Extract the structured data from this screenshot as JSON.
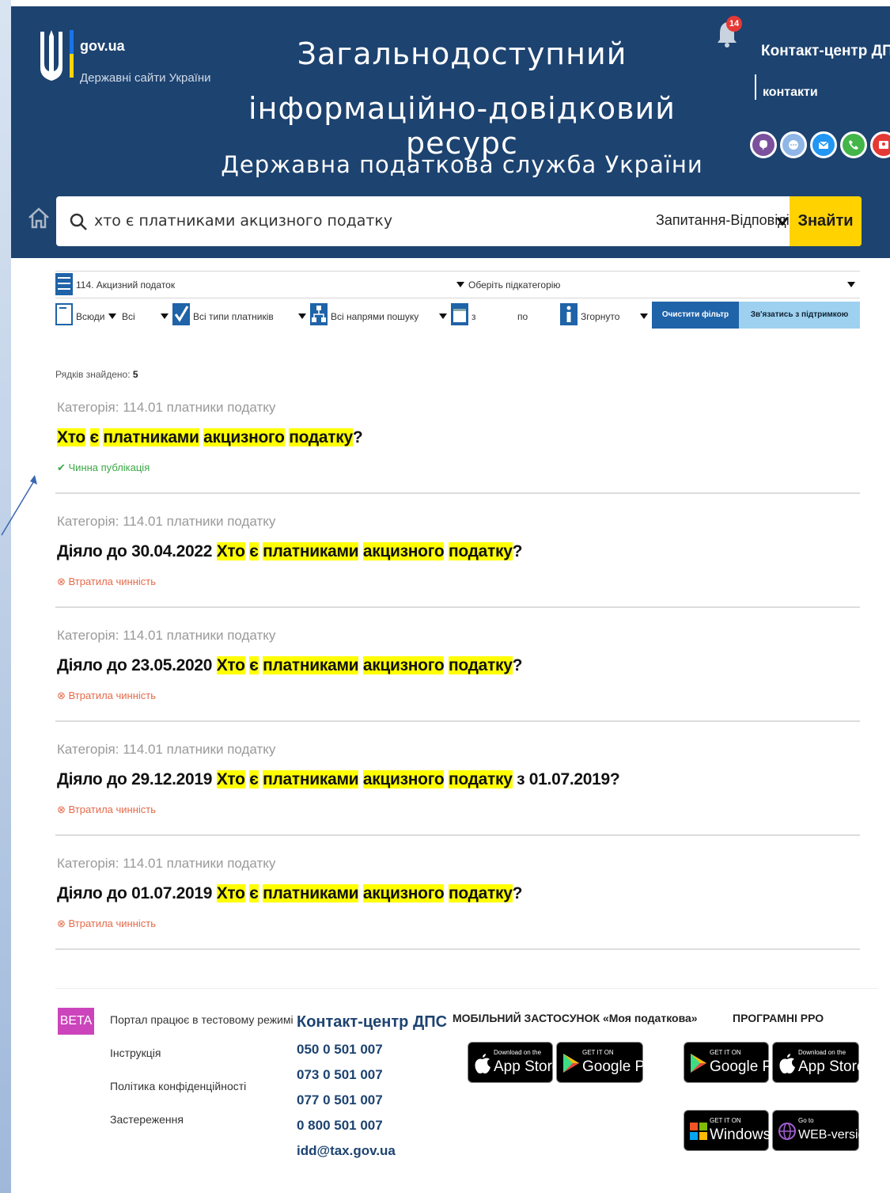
{
  "header": {
    "gov_name": "gov.ua",
    "gov_sub": "Державні сайти України",
    "title_line1": "Загальнодоступний",
    "title_line2": "інформаційно-довідковий ресурс",
    "title_line3": "Державна податкова служба України",
    "notification_count": "14",
    "contact_center": "Контакт-центр ДПС",
    "contacts_link": "контакти",
    "social": [
      {
        "name": "viber-icon",
        "color": "#7b519d"
      },
      {
        "name": "messenger-icon",
        "color": "#3b8fe0"
      },
      {
        "name": "mail-icon",
        "color": "#2196f3"
      },
      {
        "name": "phone-icon",
        "color": "#43b549"
      },
      {
        "name": "video-icon",
        "color": "#e53935"
      }
    ]
  },
  "search": {
    "query": "хто є платниками акцизного податку",
    "mode": "Запитання-Відповіді",
    "button": "Знайти"
  },
  "filters": {
    "category": "114. Акцизний податок",
    "subcategory": "Оберіть підкатегорію",
    "where": "Всюди",
    "all": "Всі",
    "payer_types": "Всі типи платників",
    "directions": "Всі напрями пошуку",
    "date_from": "з",
    "date_to": "по",
    "view": "Згорнуто",
    "clear_button": "Очистити фільтр",
    "support_button": "Зв'язатись з підтримкою"
  },
  "results": {
    "count_label": "Рядків знайдено:",
    "count": "5",
    "items": [
      {
        "category": "Категорія: 114.01 платники податку",
        "prefix": "",
        "suffix": "?",
        "status": "Чинна публікація",
        "status_type": "ok"
      },
      {
        "category": "Категорія: 114.01 платники податку",
        "prefix": "Діяло до 30.04.2022",
        "suffix": "?",
        "status": "Втратила чинність",
        "status_type": "bad"
      },
      {
        "category": "Категорія: 114.01 платники податку",
        "prefix": "Діяло до 23.05.2020",
        "suffix": "?",
        "status": "Втратила чинність",
        "status_type": "bad"
      },
      {
        "category": "Категорія: 114.01 платники податку",
        "prefix": "Діяло до 29.12.2019",
        "suffix": " з 01.07.2019?",
        "status": "Втратила чинність",
        "status_type": "bad"
      },
      {
        "category": "Категорія: 114.01 платники податку",
        "prefix": "Діяло до 01.07.2019",
        "suffix": "?",
        "status": "Втратила чинність",
        "status_type": "bad"
      }
    ],
    "highlight_words": [
      "Хто",
      "є",
      "платниками",
      "акцизного",
      "податку"
    ]
  },
  "footer": {
    "beta": "BETA",
    "links": [
      "Портал працює в тестовому режимі",
      "Інструкція",
      "Політика конфіденційності",
      "Застереження"
    ],
    "contact_title": "Контакт-центр ДПС",
    "phones": [
      "050 0 501 007",
      "073 0 501 007",
      "077 0 501 007",
      "0 800 501 007",
      "idd@tax.gov.ua"
    ],
    "mobile_app_head": "МОБІЛЬНИЙ ЗАСТОСУНОК «Моя податкова»",
    "rro_head": "ПРОГРАМНІ РРО",
    "stores": {
      "appstore_small": "Download on the",
      "appstore_big": "App Store",
      "googleplay_small": "GET IT ON",
      "googleplay_big": "Google Play",
      "windows_small": "GET IT ON",
      "windows_big": "Windows",
      "web_small": "Go to",
      "web_big": "WEB-version"
    }
  }
}
